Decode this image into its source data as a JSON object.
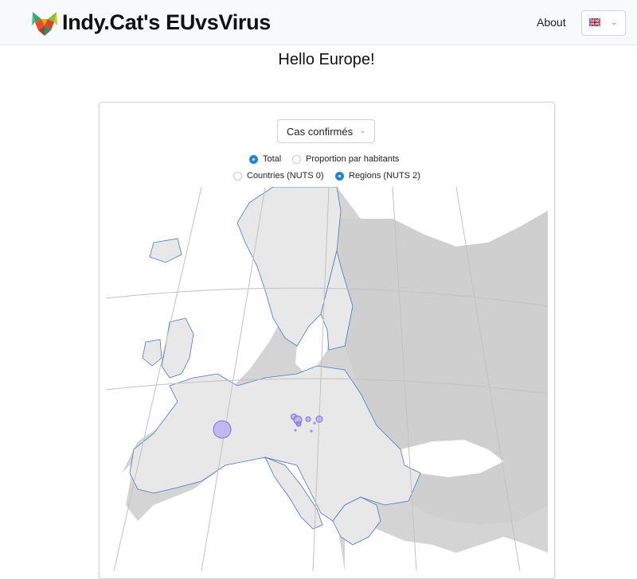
{
  "header": {
    "brand": "Indy.Cat's EUvsVirus",
    "about_link": "About",
    "language_flag": "uk-flag-icon"
  },
  "main": {
    "title": "Hello Europe!"
  },
  "controls": {
    "metric_select": {
      "value": "Cas confirmés"
    },
    "scale_options": [
      {
        "label": "Total",
        "selected": true
      },
      {
        "label": "Proportion par habitants",
        "selected": false
      }
    ],
    "level_options": [
      {
        "label": "Countries (NUTS 0)",
        "selected": false
      },
      {
        "label": "Regions (NUTS 2)",
        "selected": true
      }
    ]
  },
  "colors": {
    "accent": "#2185d0",
    "map_land_eu": "#e8e8e8",
    "map_land_other": "#cfcfcf",
    "map_water": "#ffffff",
    "coast": "#4a78c8",
    "bubble_fill": "#b4a8f0",
    "bubble_stroke": "#7d6fdc"
  }
}
